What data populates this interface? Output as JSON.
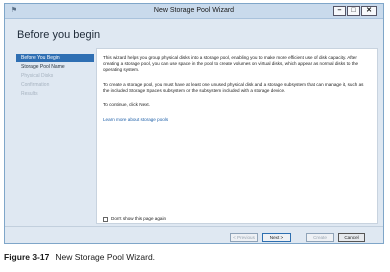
{
  "window": {
    "title": "New Storage Pool Wizard",
    "icon": "app-icon",
    "controls": {
      "minimize": "–",
      "maximize": "□",
      "close": "✕"
    }
  },
  "page": {
    "title": "Before you begin"
  },
  "sidebar": {
    "items": [
      {
        "label": "Before You Begin",
        "state": "active"
      },
      {
        "label": "Storage Pool Name",
        "state": "next"
      },
      {
        "label": "Physical Disks",
        "state": "disabled"
      },
      {
        "label": "Confirmation",
        "state": "disabled"
      },
      {
        "label": "Results",
        "state": "disabled"
      }
    ]
  },
  "content": {
    "paragraph1": "This wizard helps you group physical disks into a storage pool, enabling you to make more efficient use of disk capacity. After creating a storage pool, you can use space in the pool to create volumes on virtual disks, which appear as normal disks to the operating system.",
    "paragraph2": "To create a storage pool, you must have at least one unused physical disk and a storage subsystem that can manage it, such as the included Storage Spaces subsystem or the subsystem included with a storage device.",
    "paragraph3": "To continue, click Next.",
    "link": "Learn more about storage pools",
    "checkbox_label": "Don't show this page again"
  },
  "buttons": {
    "previous": "< Previous",
    "next": "Next >",
    "create": "Create",
    "cancel": "Cancel"
  },
  "caption": {
    "figure": "Figure 3-17",
    "text": "New Storage Pool Wizard."
  }
}
